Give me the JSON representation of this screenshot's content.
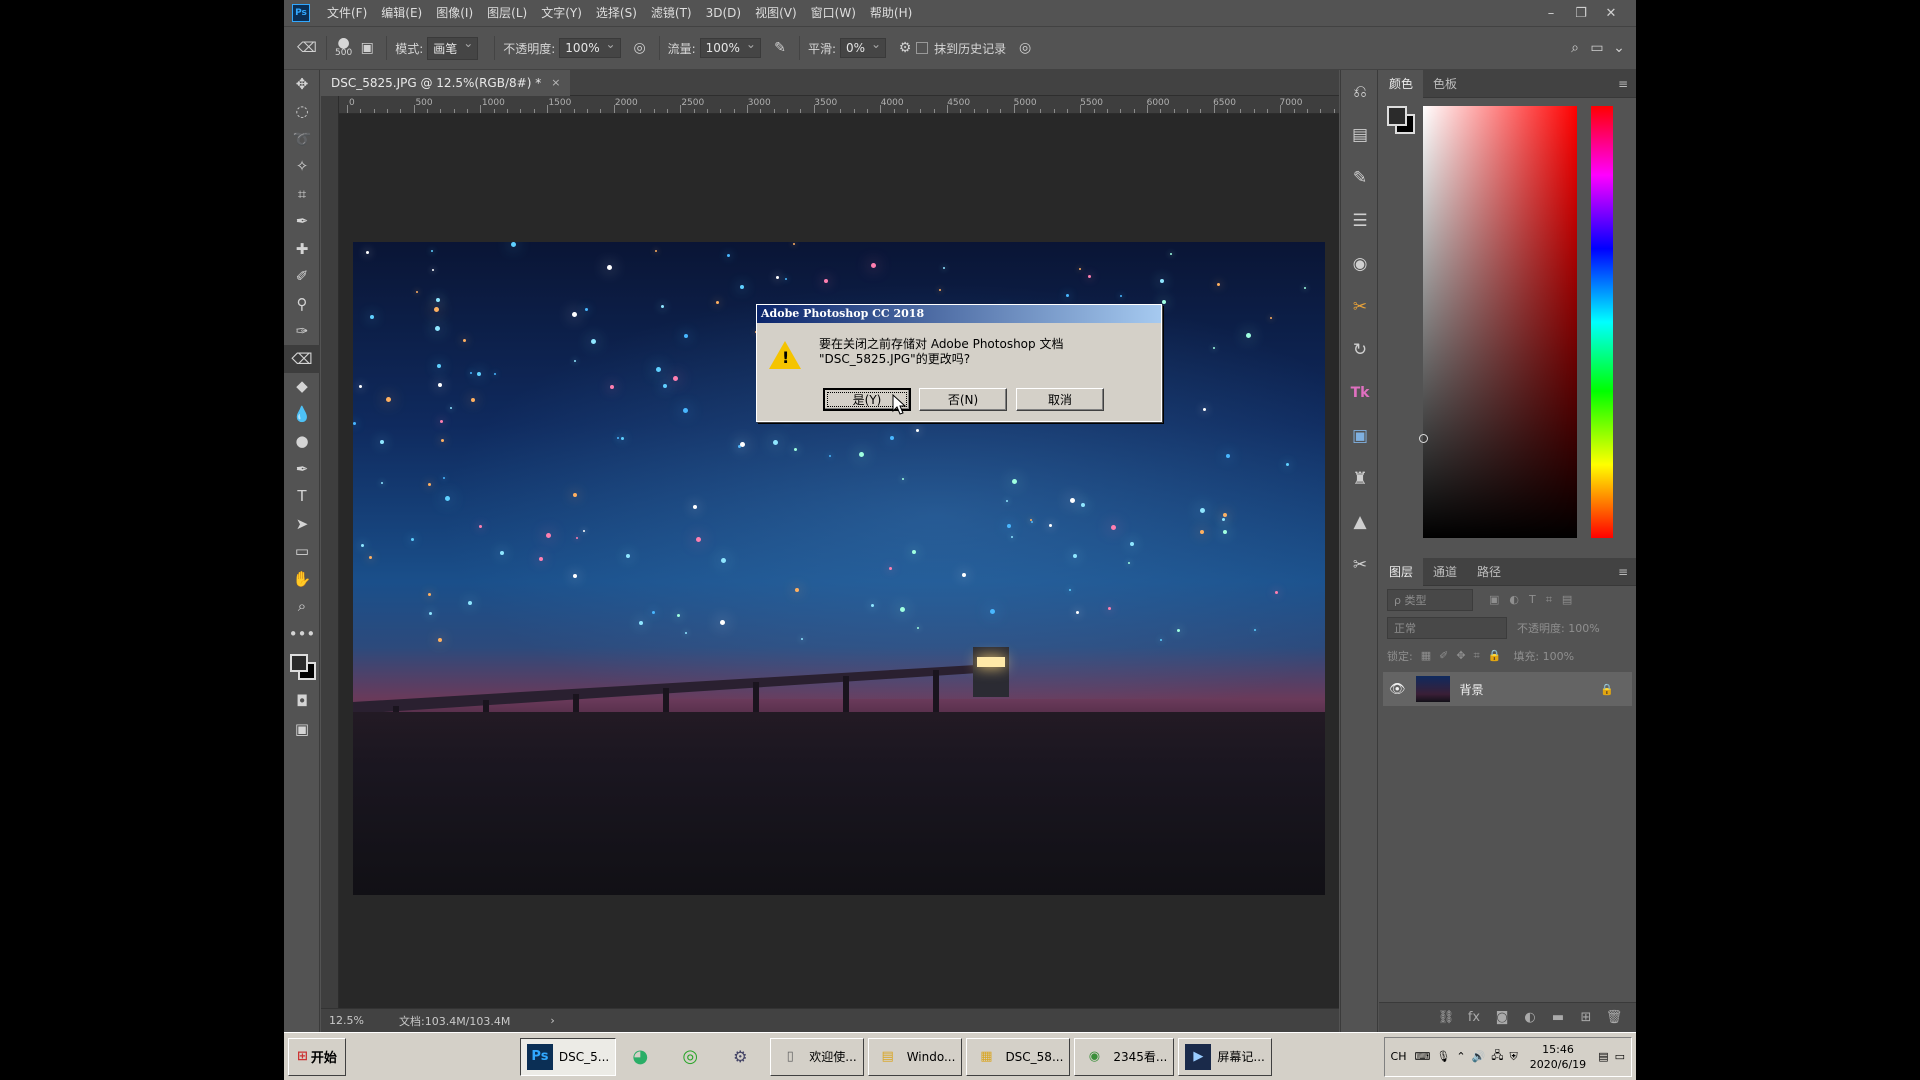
{
  "app": {
    "logo": "Ps",
    "menu": [
      "文件(F)",
      "编辑(E)",
      "图像(I)",
      "图层(L)",
      "文字(Y)",
      "选择(S)",
      "滤镜(T)",
      "3D(D)",
      "视图(V)",
      "窗口(W)",
      "帮助(H)"
    ],
    "window_controls": [
      "–",
      "❐",
      "✕"
    ]
  },
  "options": {
    "brush_size": "500",
    "mode_label": "模式:",
    "mode_value": "画笔",
    "opacity_label": "不透明度:",
    "opacity_value": "100%",
    "flow_label": "流量:",
    "flow_value": "100%",
    "smoothing_label": "平滑:",
    "smoothing_value": "0%",
    "history_label": "抹到历史记录"
  },
  "document": {
    "tab_title": "DSC_5825.JPG @ 12.5%(RGB/8#) *",
    "tab_close": "×",
    "ruler_labels": [
      "0",
      "500",
      "1000",
      "1500",
      "2000",
      "2500",
      "3000",
      "3500",
      "4000",
      "4500",
      "5000",
      "5500",
      "6000",
      "6500",
      "7000"
    ],
    "zoom": "12.5%",
    "doc_info": "文档:103.4M/103.4M",
    "status_arrow": "›"
  },
  "panels": {
    "color_tabs": [
      "颜色",
      "色板"
    ],
    "layer_tabs": [
      "图层",
      "通道",
      "路径"
    ],
    "filter_placeholder": "ρ 类型",
    "blend_mode": "正常",
    "opacity": "不透明度: 100%",
    "lock_label": "锁定:",
    "fill": "填充: 100%",
    "layer_name": "背景",
    "menu_icon": "≡"
  },
  "dialog": {
    "title": "Adobe Photoshop CC 2018",
    "message_line1": "要在关闭之前存储对 Adobe Photoshop 文档",
    "message_line2": "\"DSC_5825.JPG\"的更改吗?",
    "yes": "是(Y)",
    "no": "否(N)",
    "cancel": "取消"
  },
  "taskbar": {
    "start": "开始",
    "items": [
      {
        "icon": "Ps",
        "label": "DSC_5..."
      },
      {
        "icon": "",
        "label": "欢迎使..."
      },
      {
        "icon": "",
        "label": "Windo..."
      },
      {
        "icon": "",
        "label": "DSC_58..."
      },
      {
        "icon": "",
        "label": "2345看..."
      },
      {
        "icon": "",
        "label": "屏幕记..."
      }
    ],
    "ime": "CH",
    "time": "15:46",
    "date": "2020/6/19"
  }
}
